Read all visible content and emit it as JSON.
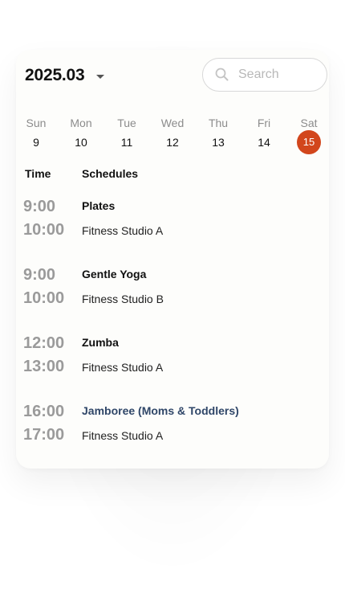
{
  "header": {
    "month": "2025.03",
    "search_placeholder": "Search"
  },
  "week": [
    {
      "name": "Sun",
      "num": "9",
      "selected": false
    },
    {
      "name": "Mon",
      "num": "10",
      "selected": false
    },
    {
      "name": "Tue",
      "num": "11",
      "selected": false
    },
    {
      "name": "Wed",
      "num": "12",
      "selected": false
    },
    {
      "name": "Thu",
      "num": "13",
      "selected": false
    },
    {
      "name": "Fri",
      "num": "14",
      "selected": false
    },
    {
      "name": "Sat",
      "num": "15",
      "selected": true
    }
  ],
  "table": {
    "col_time": "Time",
    "col_schedules": "Schedules"
  },
  "schedule": [
    {
      "start": "9:00",
      "end": "10:00",
      "title": "Plates",
      "location": "Fitness Studio A"
    },
    {
      "start": "9:00",
      "end": "10:00",
      "title": "Gentle Yoga",
      "location": "Fitness Studio B"
    },
    {
      "start": "12:00",
      "end": "13:00",
      "title": "Zumba",
      "location": "Fitness Studio A"
    },
    {
      "start": "16:00",
      "end": "17:00",
      "title": "Jamboree (Moms & Toddlers)",
      "location": "Fitness Studio A"
    }
  ],
  "colors": {
    "accent": "#d2461c",
    "link_title": "#2f4668",
    "time_gray": "#9a9a9a"
  },
  "icons": {
    "month_dropdown": "caret-down-icon",
    "search": "magnifier-icon"
  }
}
